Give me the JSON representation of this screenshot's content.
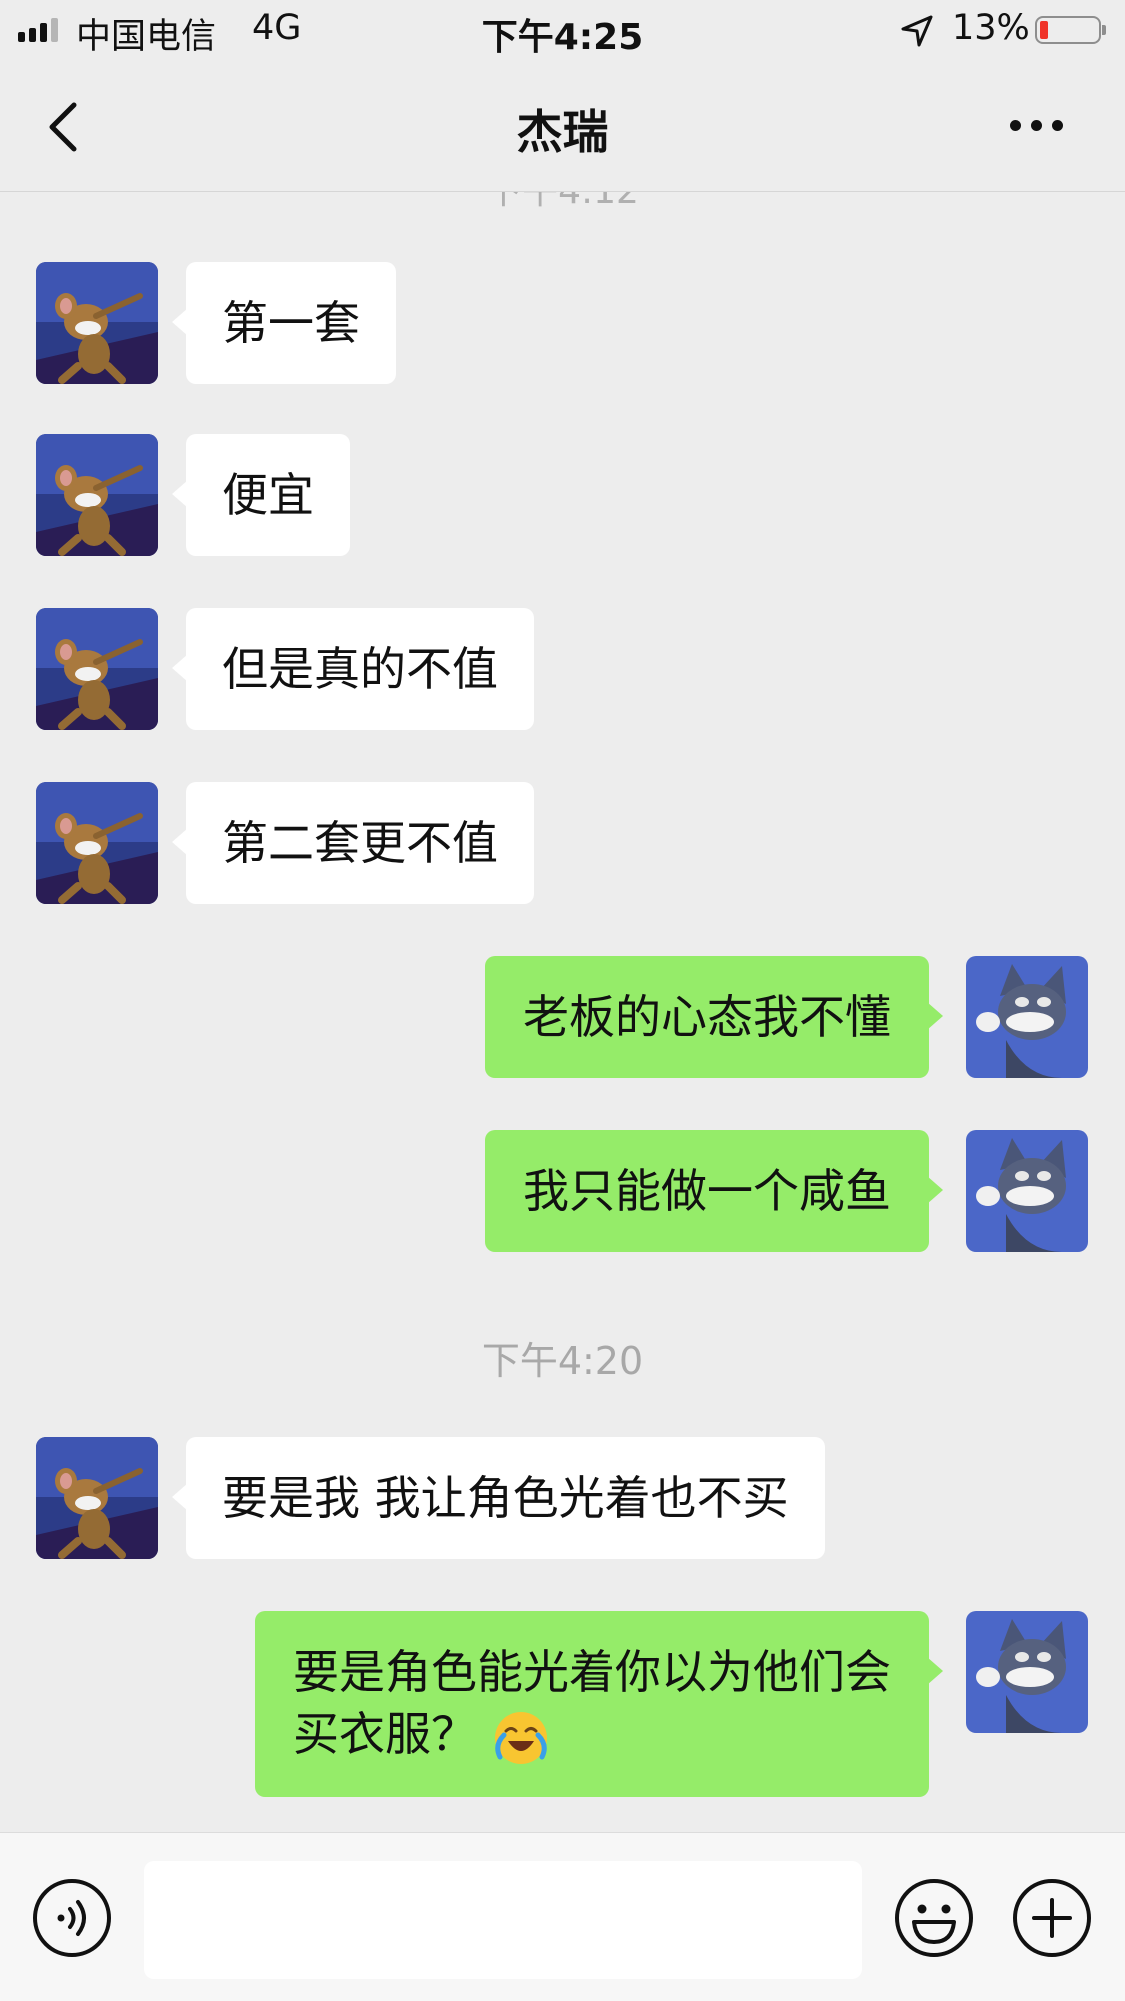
{
  "status_bar": {
    "carrier": "中国电信",
    "network": "4G",
    "time": "下午4:25",
    "battery_percent": "13%",
    "battery_level": 0.13,
    "battery_color": "#f0342a"
  },
  "nav": {
    "title": "杰瑞",
    "back_icon": "chevron-left-icon",
    "more_icon": "ellipsis-icon"
  },
  "chat": {
    "cut_off_timestamp": "下午4:12",
    "messages": [
      {
        "sender": "contact",
        "text": "第一套"
      },
      {
        "sender": "contact",
        "text": "便宜"
      },
      {
        "sender": "contact",
        "text": "但是真的不值"
      },
      {
        "sender": "contact",
        "text": "第二套更不值"
      },
      {
        "sender": "me",
        "text": "老板的心态我不懂"
      },
      {
        "sender": "me",
        "text": "我只能做一个咸鱼"
      },
      {
        "type": "timestamp",
        "text": "下午4:20"
      },
      {
        "sender": "contact",
        "text": "要是我 我让角色光着也不买"
      },
      {
        "sender": "me",
        "line1": "要是角色能光着你以为他们会",
        "line2": "买衣服？",
        "emoji": "laughing-crying-emoji"
      }
    ]
  },
  "colors": {
    "background": "#ededed",
    "my_bubble": "#95ec69",
    "contact_bubble": "#ffffff"
  },
  "input_bar": {
    "text_value": "",
    "voice_icon": "voice-icon",
    "emoji_icon": "smiley-icon",
    "plus_icon": "plus-circle-icon"
  }
}
